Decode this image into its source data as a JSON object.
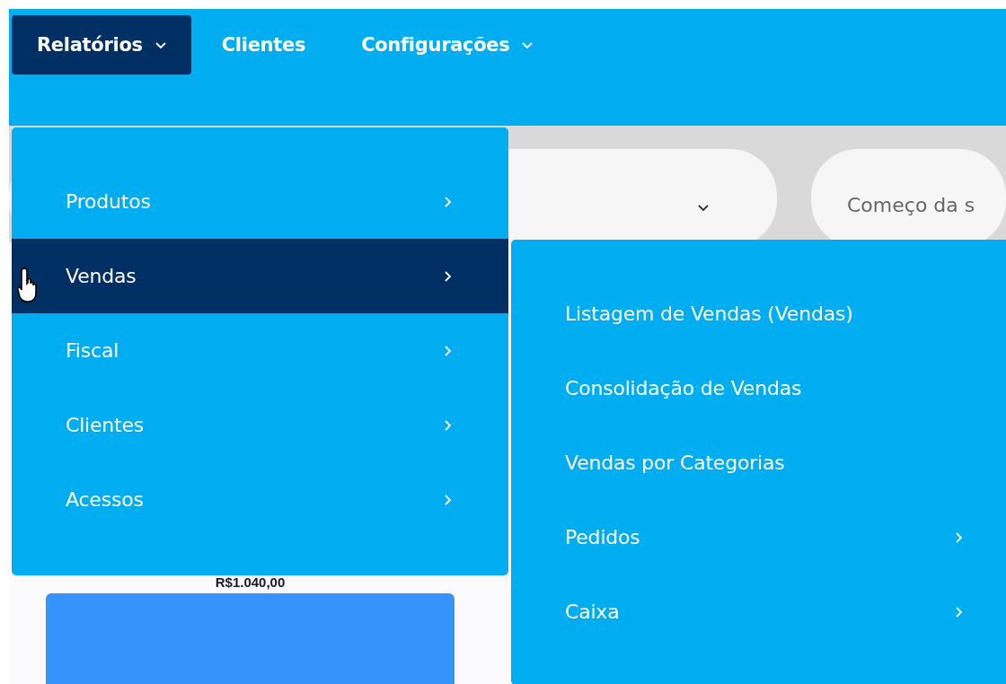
{
  "nav": [
    {
      "label": "Relatórios",
      "selected": true,
      "dropdown": true
    },
    {
      "label": "Clientes",
      "selected": false,
      "dropdown": false
    },
    {
      "label": "Configurações",
      "selected": false,
      "dropdown": true
    }
  ],
  "filters": [
    {
      "kind": "select"
    },
    {
      "kind": "date",
      "placeholder": "Começo da s"
    }
  ],
  "chart": {
    "value_label": "R$1.040,00"
  },
  "menu": {
    "items": [
      {
        "label": "Produtos",
        "selected": false,
        "has_submenu": true
      },
      {
        "label": "Vendas",
        "selected": true,
        "has_submenu": true
      },
      {
        "label": "Fiscal",
        "selected": false,
        "has_submenu": true
      },
      {
        "label": "Clientes",
        "selected": false,
        "has_submenu": true
      },
      {
        "label": "Acessos",
        "selected": false,
        "has_submenu": true
      }
    ]
  },
  "submenu": {
    "items": [
      {
        "label": "Listagem de Vendas (Vendas)",
        "selected": false,
        "has_submenu": false
      },
      {
        "label": "Consolidação de Vendas",
        "selected": false,
        "has_submenu": false
      },
      {
        "label": "Vendas por Categorias",
        "selected": false,
        "has_submenu": false
      },
      {
        "label": "Pedidos",
        "selected": false,
        "has_submenu": true
      },
      {
        "label": "Caixa",
        "selected": false,
        "has_submenu": true
      }
    ]
  }
}
